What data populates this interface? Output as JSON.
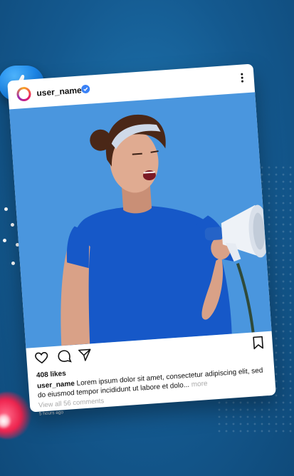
{
  "post": {
    "username": "user_name",
    "likes": "408 likes",
    "caption_user": "user_name",
    "caption_text": " Lorem ipsum dolor sit amet, consectetur adipiscing elit, sed do eiusmod tempor incididunt ut labore et dolo...",
    "caption_more": " more",
    "comments_link": "View all 56 comments",
    "time_ago": "5 hours ago"
  },
  "icons": {
    "like_bubble": "thumbs-up-icon",
    "heart_glow": "heart-icon",
    "verified": "verified-check-icon",
    "more": "more-vertical-icon",
    "like": "heart-outline-icon",
    "comment": "comment-icon",
    "share": "send-icon",
    "save": "bookmark-icon"
  },
  "colors": {
    "background": "#14598f",
    "post_image_bg": "#4a96de",
    "shirt": "#1658c8",
    "verified": "#3b82f6"
  }
}
